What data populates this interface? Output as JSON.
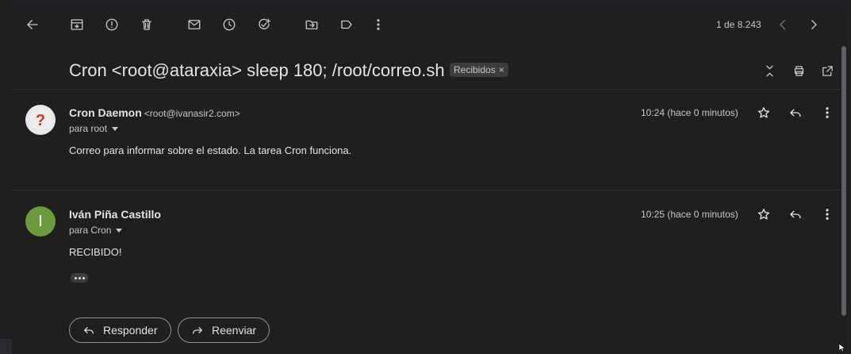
{
  "toolbar": {
    "icons": [
      "back-icon",
      "archive-icon",
      "report-spam-icon",
      "delete-icon",
      "mark-unread-icon",
      "snooze-icon",
      "add-task-icon",
      "move-to-icon",
      "label-icon",
      "more-icon"
    ],
    "pager": "1 de 8.243"
  },
  "subject": {
    "text": "Cron <root@ataraxia> sleep 180; /root/correo.sh",
    "label": "Recibidos",
    "label_remove": "×"
  },
  "messages": [
    {
      "sender_name": "Cron Daemon",
      "sender_email": "<root@ivanasir2.com>",
      "to": "para root",
      "time": "10:24 (hace 0 minutos)",
      "body": "Correo para informar sobre el estado. La tarea Cron funciona.",
      "avatar": "?"
    },
    {
      "sender_name": "Iván Piña Castillo",
      "to": "para Cron",
      "time": "10:25 (hace 0 minutos)",
      "body": "RECIBIDO!",
      "avatar": "I"
    }
  ],
  "actions": {
    "reply": "Responder",
    "forward": "Reenviar"
  },
  "colors": {
    "background": "#1f1f1f",
    "avatar_green": "#6c9b3d",
    "avatar_unknown_mark": "#d93025"
  }
}
